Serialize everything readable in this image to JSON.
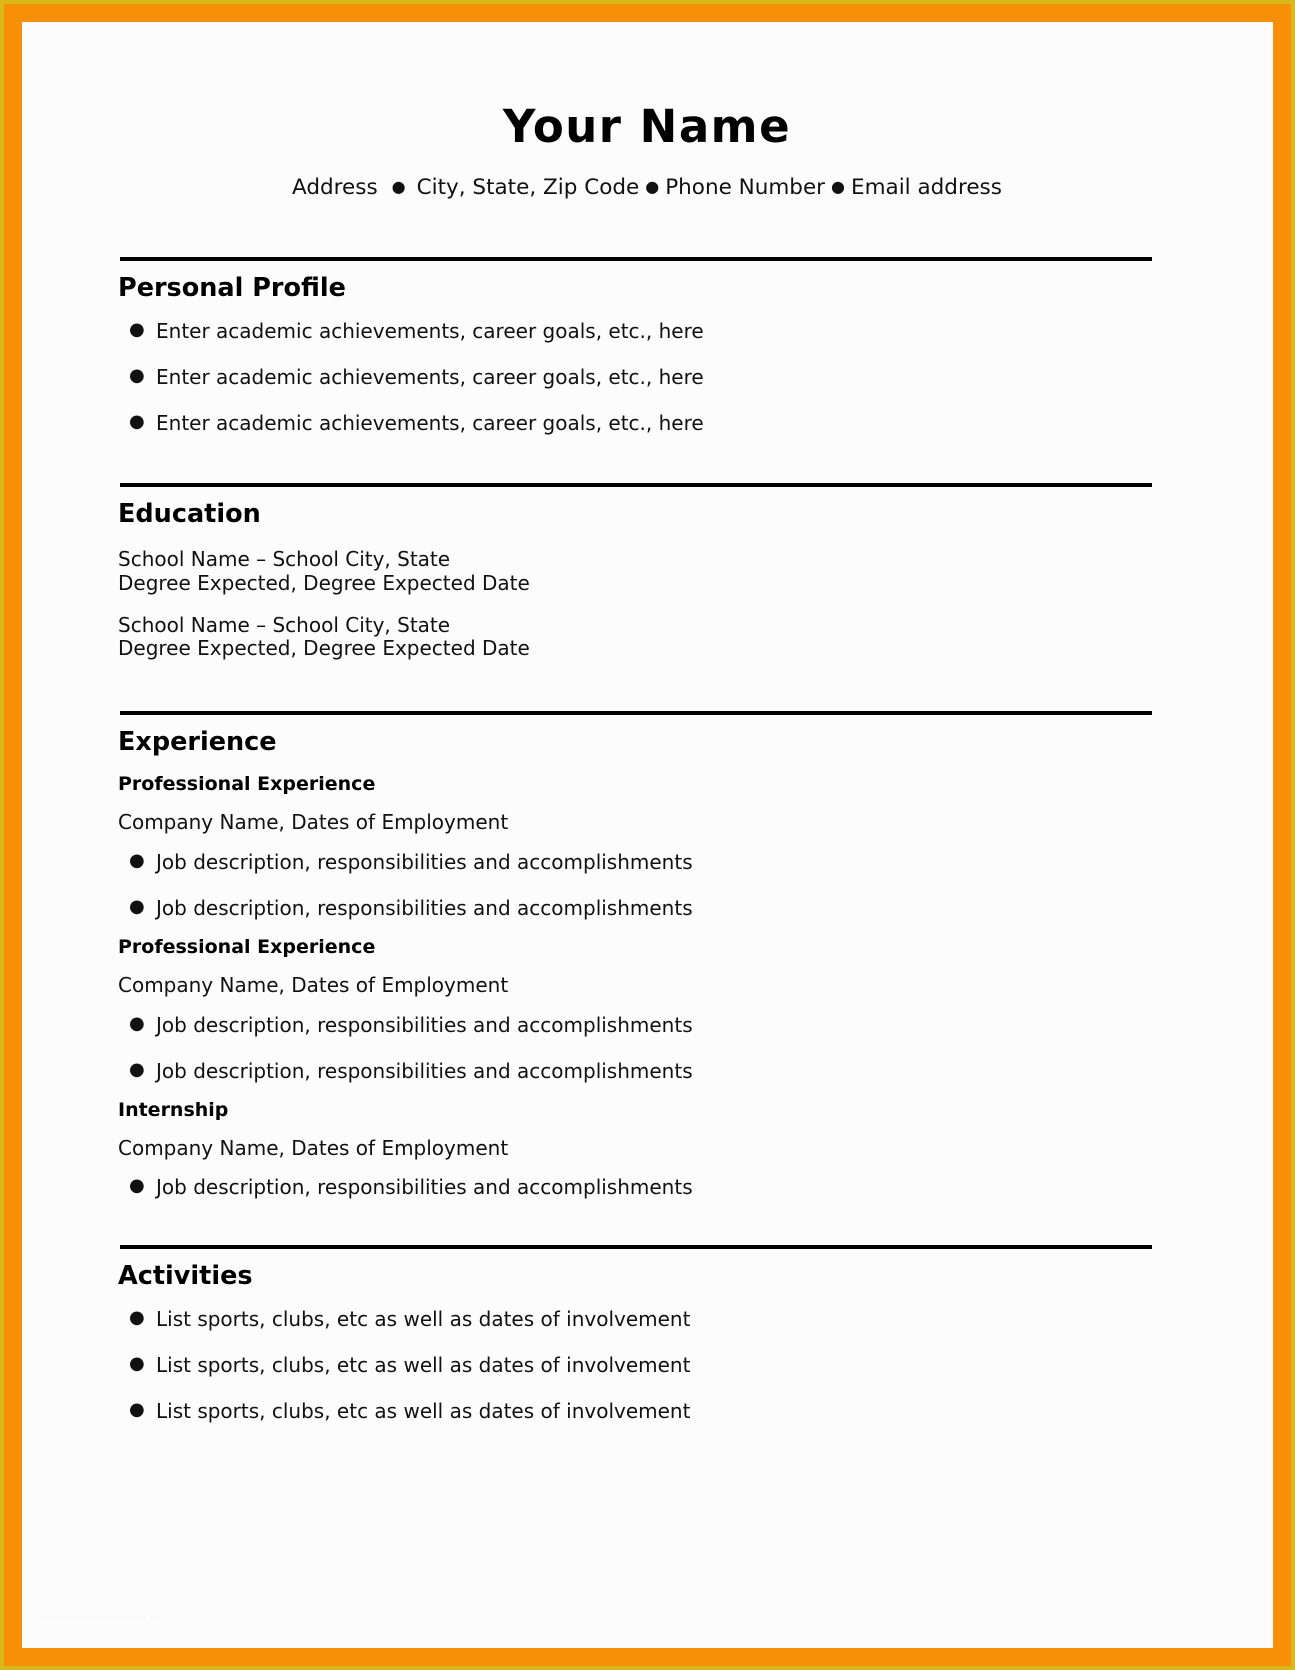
{
  "document": {
    "type": "resume-template",
    "frame_outer_color": "#d9b81c",
    "frame_band_color": "#f78f08",
    "paper_color": "#fcfcfc",
    "rule_color": "#000000"
  },
  "header": {
    "name": "Your Name",
    "contact": {
      "address": "Address",
      "city_state_zip": "City, State, Zip Code",
      "phone": "Phone Number",
      "email": "Email address",
      "separator": "●"
    }
  },
  "sections": {
    "profile": {
      "title": "Personal Profile",
      "bullets": [
        "Enter academic achievements, career goals, etc., here",
        "Enter academic achievements, career goals, etc., here",
        "Enter academic achievements, career goals, etc., here"
      ]
    },
    "education": {
      "title": "Education",
      "entries": [
        {
          "school": "School Name – School City, State",
          "degree": "Degree Expected, Degree Expected Date"
        },
        {
          "school": "School Name – School City, State",
          "degree": "Degree Expected, Degree Expected Date"
        }
      ]
    },
    "experience": {
      "title": "Experience",
      "entries": [
        {
          "subtitle": "Professional Experience",
          "company": "Company Name, Dates of Employment",
          "bullets": [
            "Job description, responsibilities and accomplishments",
            "Job description, responsibilities and accomplishments"
          ]
        },
        {
          "subtitle": "Professional Experience",
          "company": "Company Name, Dates of Employment",
          "bullets": [
            "Job description, responsibilities and accomplishments",
            "Job description, responsibilities and accomplishments"
          ]
        },
        {
          "subtitle": "Internship",
          "company": "Company Name, Dates of Employment",
          "bullets": [
            "Job description, responsibilities and accomplishments"
          ]
        }
      ]
    },
    "activities": {
      "title": "Activities",
      "bullets": [
        "List sports, clubs, etc as well as dates of involvement",
        "List sports, clubs, etc as well as dates of involvement",
        "List sports, clubs, etc as well as dates of involvement"
      ]
    }
  },
  "watermark": {
    "text": "www.heritagechristiancollege.com"
  },
  "bullet_glyph": "●"
}
